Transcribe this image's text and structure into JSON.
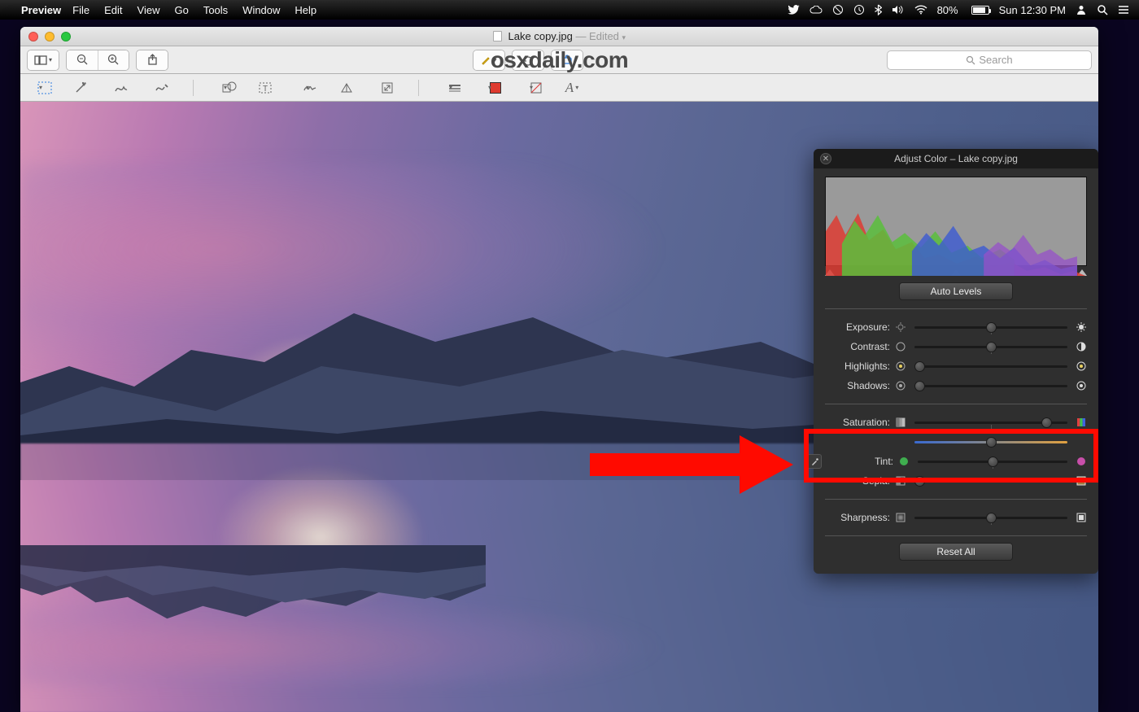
{
  "menubar": {
    "app": "Preview",
    "items": [
      "File",
      "Edit",
      "View",
      "Go",
      "Tools",
      "Window",
      "Help"
    ],
    "battery": "80%",
    "clock": "Sun 12:30 PM"
  },
  "window": {
    "filename": "Lake copy.jpg",
    "status": "— Edited",
    "watermark": "osxdaily.com",
    "search_placeholder": "Search"
  },
  "panel": {
    "title": "Adjust Color – Lake copy.jpg",
    "auto_levels": "Auto Levels",
    "reset_all": "Reset All",
    "sliders": {
      "exposure": {
        "label": "Exposure:",
        "pos": 50
      },
      "contrast": {
        "label": "Contrast:",
        "pos": 50
      },
      "highlights": {
        "label": "Highlights:",
        "pos": 3
      },
      "shadows": {
        "label": "Shadows:",
        "pos": 3
      },
      "saturation": {
        "label": "Saturation:",
        "pos": 86
      },
      "temperature": {
        "label": "",
        "pos": 50
      },
      "tint": {
        "label": "Tint:",
        "pos": 50
      },
      "sepia": {
        "label": "Sepia:",
        "pos": 3
      },
      "sharpness": {
        "label": "Sharpness:",
        "pos": 50
      }
    }
  }
}
